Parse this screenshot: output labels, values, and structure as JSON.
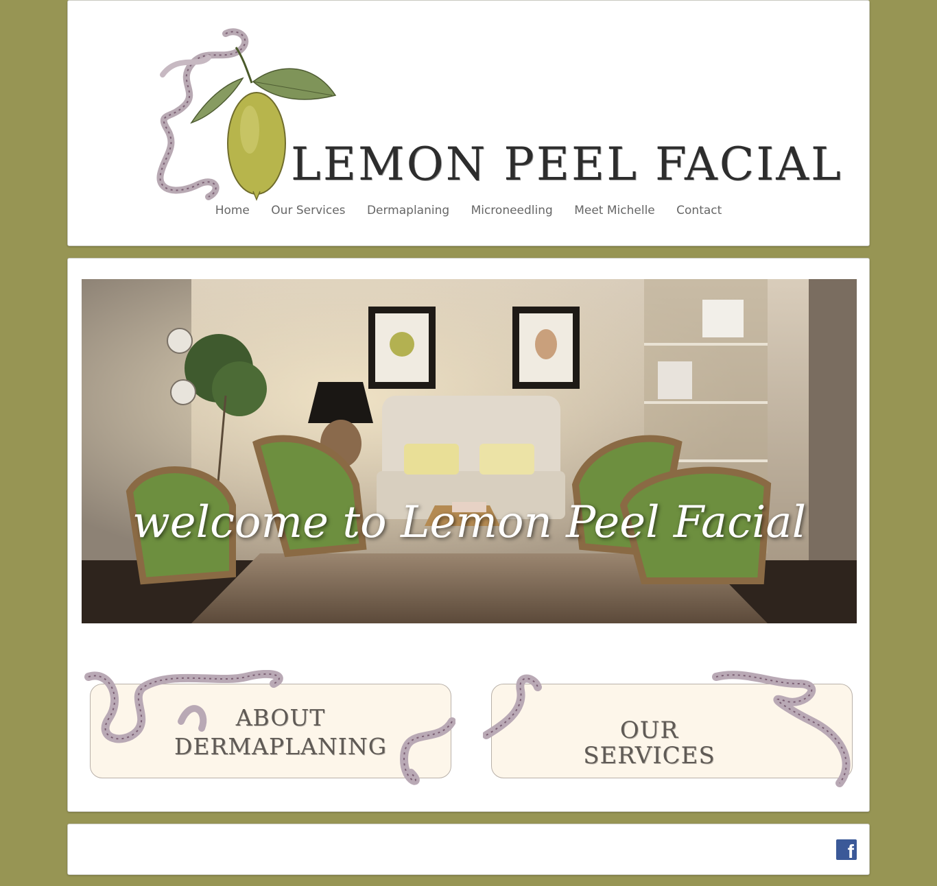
{
  "site": {
    "logo_text": "LEMON PEEL FACIAL"
  },
  "nav": {
    "items": [
      {
        "label": "Home"
      },
      {
        "label": "Our Services"
      },
      {
        "label": "Dermaplaning"
      },
      {
        "label": "Microneedling"
      },
      {
        "label": "Meet Michelle"
      },
      {
        "label": "Contact"
      }
    ]
  },
  "hero": {
    "title": "welcome to Lemon Peel Facial"
  },
  "banners": {
    "about": {
      "line1": "ABOUT",
      "line2": "DERMAPLANING"
    },
    "services": {
      "label": "OUR SERVICES"
    }
  },
  "footer": {
    "facebook_icon": "facebook-icon",
    "facebook_glyph": "f"
  },
  "colors": {
    "page_background": "#979554",
    "nav_text": "#666666",
    "facebook": "#3b5998"
  }
}
